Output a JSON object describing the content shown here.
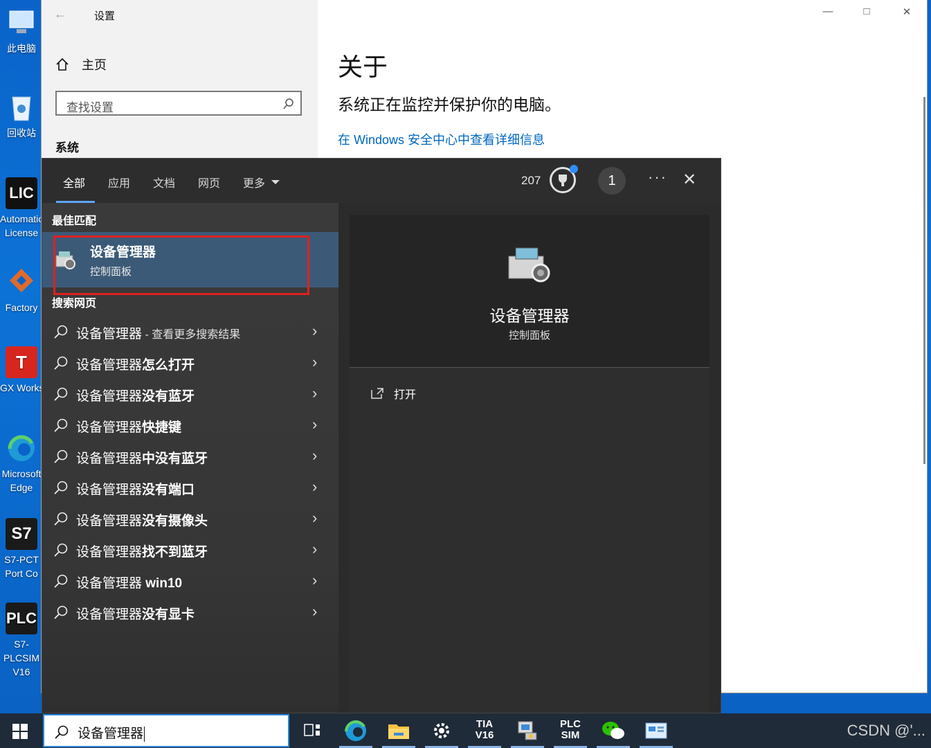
{
  "desktop_icons": [
    {
      "label": "此电脑",
      "icon": "this-pc-icon"
    },
    {
      "label": "回收站",
      "icon": "recycle-bin-icon"
    },
    {
      "label": "Automation License",
      "icon": "license-manager-icon"
    },
    {
      "label": "Factory",
      "icon": "factory-io-icon"
    },
    {
      "label": "GX Works",
      "icon": "gx-works-icon"
    },
    {
      "label": "Microsoft Edge",
      "icon": "edge-icon"
    },
    {
      "label": "S7-PCT Port Co",
      "icon": "s7-pct-icon"
    },
    {
      "label": "S7-PLCSIM V16",
      "icon": "plcsim-icon"
    }
  ],
  "settings_window": {
    "title": "设置",
    "home": "主页",
    "search_placeholder": "查找设置",
    "section": "系统",
    "page_title": "关于",
    "status_text": "系统正在监控并保护你的电脑。",
    "link_text": "在 Windows 安全中心中查看详细信息"
  },
  "search_panel": {
    "tabs": [
      "全部",
      "应用",
      "文档",
      "网页",
      "更多"
    ],
    "active_tab": "全部",
    "points": "207",
    "avatar_text": "1",
    "best_match_heading": "最佳匹配",
    "best_match": {
      "name": "设备管理器",
      "category": "控制面板"
    },
    "web_heading": "搜索网页",
    "web_results": [
      {
        "prefix": "设备管理器",
        "suffix": "",
        "extra": " - 查看更多搜索结果"
      },
      {
        "prefix": "设备管理器",
        "suffix": "怎么打开",
        "extra": ""
      },
      {
        "prefix": "设备管理器",
        "suffix": "没有蓝牙",
        "extra": ""
      },
      {
        "prefix": "设备管理器",
        "suffix": "快捷键",
        "extra": ""
      },
      {
        "prefix": "设备管理器",
        "suffix": "中没有蓝牙",
        "extra": ""
      },
      {
        "prefix": "设备管理器",
        "suffix": "没有端口",
        "extra": ""
      },
      {
        "prefix": "设备管理器",
        "suffix": "没有摄像头",
        "extra": ""
      },
      {
        "prefix": "设备管理器",
        "suffix": "找不到蓝牙",
        "extra": ""
      },
      {
        "prefix": "设备管理器 ",
        "suffix": "win10",
        "extra": ""
      },
      {
        "prefix": "设备管理器",
        "suffix": "没有显卡",
        "extra": ""
      }
    ],
    "preview": {
      "name": "设备管理器",
      "category": "控制面板",
      "action_open": "打开"
    }
  },
  "taskbar": {
    "search_query": "设备管理器",
    "apps": [
      "task-view-icon",
      "edge-icon",
      "file-explorer-icon",
      "settings-icon",
      "tia-portal-icon",
      "device-manager-icon",
      "plcsim-icon",
      "wechat-icon",
      "control-panel-icon"
    ],
    "tia_label": "TIA V16",
    "plc_label": "PLC SIM",
    "watermark": "CSDN @'..."
  }
}
